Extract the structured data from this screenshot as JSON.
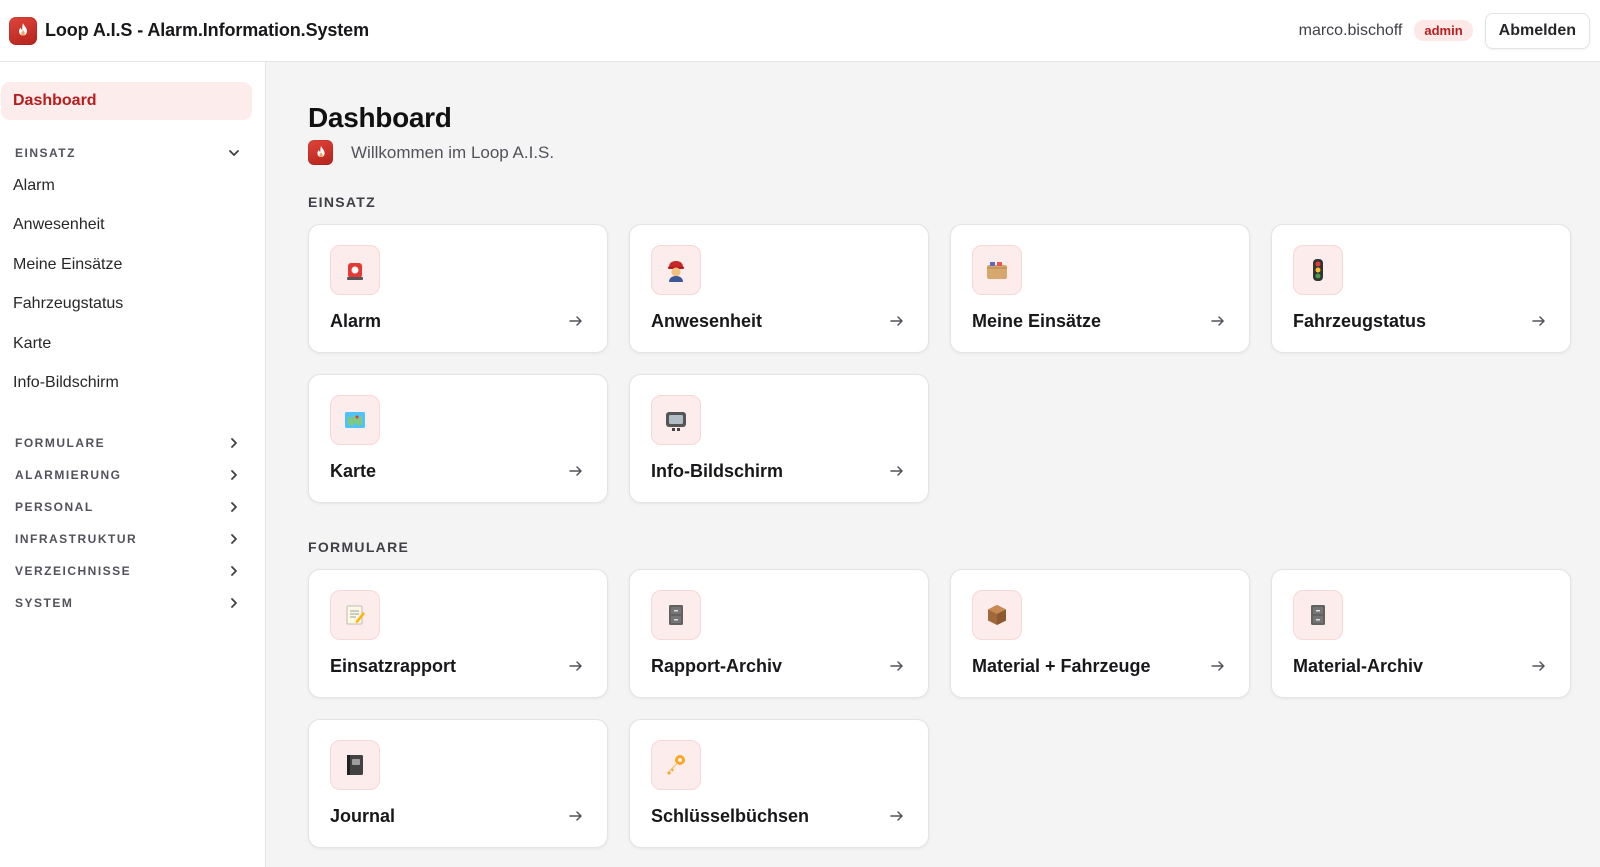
{
  "header": {
    "title": "Loop A.I.S - Alarm.Information.System",
    "logo_icon": "fire-logo-icon",
    "username": "marco.bischoff",
    "role": "admin",
    "logout_label": "Abmelden"
  },
  "sidebar": {
    "active_item": "Dashboard",
    "groups": [
      {
        "label": "EINSATZ",
        "expanded": true,
        "items": [
          "Alarm",
          "Anwesenheit",
          "Meine Einsätze",
          "Fahrzeugstatus",
          "Karte",
          "Info-Bildschirm"
        ]
      },
      {
        "label": "FORMULARE",
        "expanded": false
      },
      {
        "label": "ALARMIERUNG",
        "expanded": false
      },
      {
        "label": "PERSONAL",
        "expanded": false
      },
      {
        "label": "INFRASTRUKTUR",
        "expanded": false
      },
      {
        "label": "VERZEICHNISSE",
        "expanded": false
      },
      {
        "label": "SYSTEM",
        "expanded": false
      }
    ]
  },
  "main": {
    "title": "Dashboard",
    "subtitle": "Willkommen im Loop A.I.S.",
    "sections": [
      {
        "label": "EINSATZ",
        "cards": [
          {
            "label": "Alarm",
            "icon": "siren-icon"
          },
          {
            "label": "Anwesenheit",
            "icon": "firefighter-icon"
          },
          {
            "label": "Meine Einsätze",
            "icon": "folder-icon"
          },
          {
            "label": "Fahrzeugstatus",
            "icon": "traffic-light-icon"
          },
          {
            "label": "Karte",
            "icon": "map-icon"
          },
          {
            "label": "Info-Bildschirm",
            "icon": "tv-icon"
          }
        ]
      },
      {
        "label": "FORMULARE",
        "cards": [
          {
            "label": "Einsatzrapport",
            "icon": "memo-icon"
          },
          {
            "label": "Rapport-Archiv",
            "icon": "file-cabinet-icon"
          },
          {
            "label": "Material + Fahrzeuge",
            "icon": "package-icon"
          },
          {
            "label": "Material-Archiv",
            "icon": "file-cabinet-icon"
          },
          {
            "label": "Journal",
            "icon": "notebook-icon"
          },
          {
            "label": "Schlüsselbüchsen",
            "icon": "key-icon"
          }
        ]
      }
    ]
  },
  "colors": {
    "accent": "#b91c1c",
    "accent_bg": "#fdecec",
    "page_bg": "#f4f4f5",
    "card_bg": "#ffffff"
  }
}
